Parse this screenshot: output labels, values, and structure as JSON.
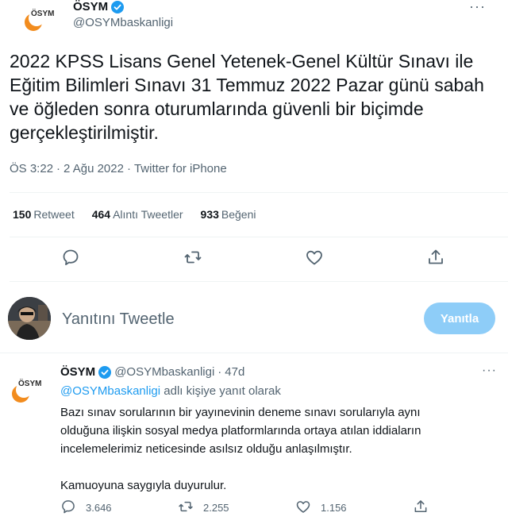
{
  "tweet": {
    "display_name": "ÖSYM",
    "handle": "@OSYMbaskanligi",
    "logo_text": "ÖSYM",
    "more": "···",
    "text": "2022 KPSS Lisans Genel Yetenek-Genel Kültür Sınavı ile Eğitim Bilimleri Sınavı 31 Temmuz 2022 Pazar günü sabah ve öğleden sonra oturumlarında güvenli bir biçimde gerçekleştirilmiştir.",
    "time": "ÖS 3:22",
    "dot1": "·",
    "date": "2 Ağu 2022",
    "dot2": "·",
    "source": "Twitter for iPhone"
  },
  "stats": {
    "retweets_count": "150",
    "retweets_label": "Retweet",
    "quotes_count": "464",
    "quotes_label": "Alıntı Tweetler",
    "likes_count": "933",
    "likes_label": "Beğeni"
  },
  "actions": [
    "reply-icon",
    "retweet-icon",
    "like-icon",
    "share-icon"
  ],
  "reply_box": {
    "placeholder": "Yanıtını Tweetle",
    "button": "Yanıtla"
  },
  "reply": {
    "display_name": "ÖSYM",
    "handle": "@OSYMbaskanligi",
    "dot": "·",
    "age": "47d",
    "more": "···",
    "replying_mention": "@OSYMbaskanligi",
    "replying_suffix": "adlı kişiye yanıt olarak",
    "body_line1": "Bazı sınav sorularının bir yayınevinin deneme sınavı sorularıyla aynı",
    "body_line2": "olduğuna ilişkin sosyal medya platformlarında ortaya atılan iddiaların",
    "body_line3": "incelemelerimiz neticesinde asılsız olduğu anlaşılmıştır.",
    "body_line4": "Kamuoyuna saygıyla duyurulur.",
    "reply_count": "3.646",
    "retweet_count": "2.255",
    "like_count": "1.156"
  },
  "colors": {
    "accent": "#1d9bf0",
    "reply_button": "#8ecdf8",
    "logo_orange": "#f28c1e",
    "secondary_text": "#536471"
  }
}
